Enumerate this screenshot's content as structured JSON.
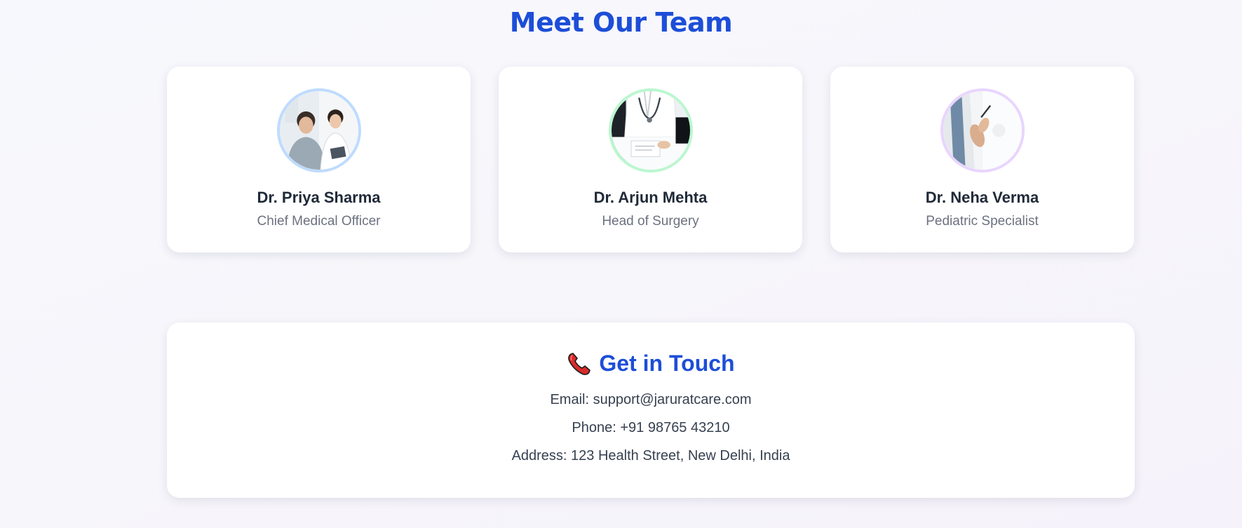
{
  "team": {
    "title": "Meet Our Team",
    "members": [
      {
        "name": "Dr. Priya Sharma",
        "role": "Chief Medical Officer",
        "accent": "#bfdbfe"
      },
      {
        "name": "Dr. Arjun Mehta",
        "role": "Head of Surgery",
        "accent": "#bbf7d0"
      },
      {
        "name": "Dr. Neha Verma",
        "role": "Pediatric Specialist",
        "accent": "#e9d5ff"
      }
    ]
  },
  "contact": {
    "title": "Get in Touch",
    "icon": "telephone-icon",
    "email": "Email: support@jaruratcare.com",
    "phone": "Phone: +91 98765 43210",
    "address": "Address: 123 Health Street, New Delhi, India"
  },
  "colors": {
    "heading": "#1d4ed8",
    "name": "#1f2937",
    "role": "#6b7280"
  }
}
